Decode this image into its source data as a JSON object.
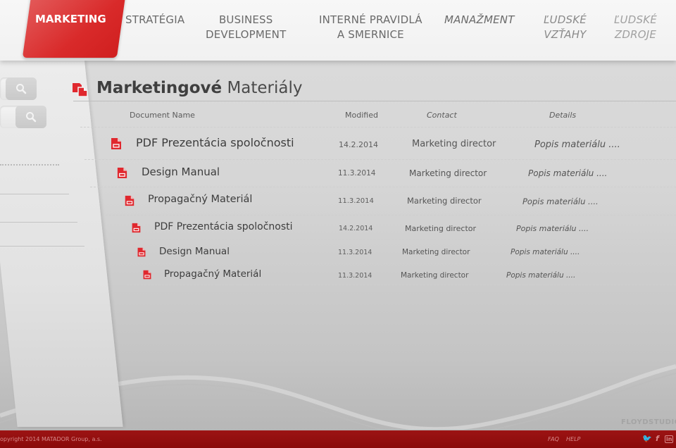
{
  "nav": {
    "active": "MARKETING",
    "items": [
      {
        "label_line1": "STRATÉGIA",
        "label_line2": ""
      },
      {
        "label_line1": "BUSINESS",
        "label_line2": "DEVELOPMENT"
      },
      {
        "label_line1": "INTERNÉ PRAVIDLÁ",
        "label_line2": "A SMERNICE"
      },
      {
        "label_line1": "MANAŽMENT",
        "label_line2": ""
      },
      {
        "label_line1": "ĽUDSKÉ",
        "label_line2": "VZŤAHY"
      },
      {
        "label_line1": "ĽUDSKÉ",
        "label_line2": "ZDROJE"
      }
    ]
  },
  "sidebar": {
    "search_icon": "search-icon"
  },
  "page": {
    "title_bold": "Marketingové",
    "title_regular": "Materiály",
    "title_icon": "documents-icon"
  },
  "table": {
    "columns": [
      "Document Name",
      "Modified",
      "Contact",
      "Details"
    ],
    "rows": [
      {
        "name": "PDF Prezentácia spoločnosti",
        "modified": "14.2.2014",
        "contact": "Marketing director",
        "details": "Popis materiálu ...."
      },
      {
        "name": "Design Manual",
        "modified": "11.3.2014",
        "contact": "Marketing director",
        "details": "Popis materiálu ...."
      },
      {
        "name": "Propagačný Materiál",
        "modified": "11.3.2014",
        "contact": "Marketing director",
        "details": "Popis materiálu ...."
      },
      {
        "name": "PDF Prezentácia spoločnosti",
        "modified": "14.2.2014",
        "contact": "Marketing director",
        "details": "Popis materiálu ...."
      },
      {
        "name": "Design Manual",
        "modified": "11.3.2014",
        "contact": "Marketing director",
        "details": "Popis materiálu ...."
      },
      {
        "name": "Propagačný Materiál",
        "modified": "11.3.2014",
        "contact": "Marketing director",
        "details": "Popis materiálu ...."
      }
    ]
  },
  "footer": {
    "copyright": "opyright 2014 MATADOR Group, a.s.",
    "links": [
      "FAQ",
      "HELP"
    ],
    "social": [
      "twitter-icon",
      "facebook-icon",
      "linkedin-icon"
    ],
    "watermark": "FLOYDSTUDIO"
  },
  "colors": {
    "accent": "#d92a2a",
    "footer": "#8a0a0a",
    "doc_icon": "#e0282e"
  }
}
